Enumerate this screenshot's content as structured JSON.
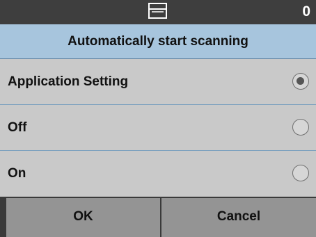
{
  "status_bar": {
    "counter": "0",
    "tray_icon": "tray-icon"
  },
  "dialog": {
    "title": "Automatically start scanning",
    "options": [
      {
        "label": "Application Setting",
        "selected": true
      },
      {
        "label": "Off",
        "selected": false
      },
      {
        "label": "On",
        "selected": false
      }
    ]
  },
  "buttons": {
    "ok_label": "OK",
    "cancel_label": "Cancel"
  },
  "colors": {
    "status_bar_bg": "#3e3e3e",
    "title_bg": "#a7c5dd",
    "row_bg": "#c9c9c9",
    "divider": "#7ba0bf",
    "button_bg": "#949494"
  }
}
